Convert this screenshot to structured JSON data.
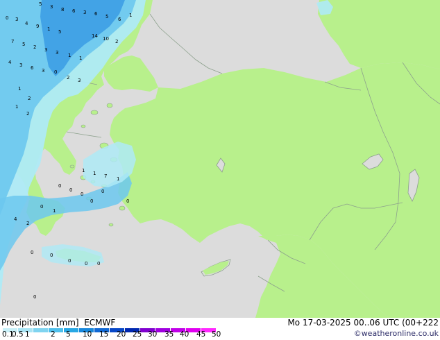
{
  "footer": {
    "title": "Precipitation [mm]",
    "model": "ECMWF",
    "valid": "Mo 17-03-2025 00..06 UTC (00+222",
    "credit": "©weatheronline.co.uk"
  },
  "legend": {
    "values": [
      "0.1",
      "0.5",
      "1",
      "2",
      "5",
      "10",
      "15",
      "20",
      "25",
      "30",
      "35",
      "40",
      "45",
      "50"
    ],
    "colors": [
      "#c8f0f8",
      "#a8e4f4",
      "#80d4f0",
      "#50c0ec",
      "#28a8e4",
      "#1888dc",
      "#1068d4",
      "#0848c8",
      "#0028b0",
      "#8000d0",
      "#a000e0",
      "#c000e8",
      "#e000f0",
      "#ff28ff"
    ]
  },
  "map": {
    "land_color": "#b8f08c",
    "sea_color": "#dcdcdc",
    "border_color": "#8ca08c",
    "precip_light": "#aeeaf6",
    "precip_mid": "#6cc8ee",
    "precip_heavy": "#3a9ce4",
    "values": [
      "5",
      "3",
      "8",
      "6",
      "3",
      "6",
      "5",
      "6",
      "1",
      "0",
      "3",
      "4",
      "9",
      "1",
      "5",
      "14",
      "10",
      "2",
      "7",
      "5",
      "2",
      "3",
      "3",
      "1",
      "1",
      "4",
      "3",
      "6",
      "3",
      "0",
      "2",
      "3",
      "1",
      "2",
      "1",
      "2",
      "1",
      "1",
      "7",
      "1",
      "4",
      "2",
      "0",
      "1",
      "0",
      "0",
      "0",
      "0",
      "0",
      "0",
      "0",
      "0",
      "0",
      "0",
      "0",
      "0"
    ]
  }
}
